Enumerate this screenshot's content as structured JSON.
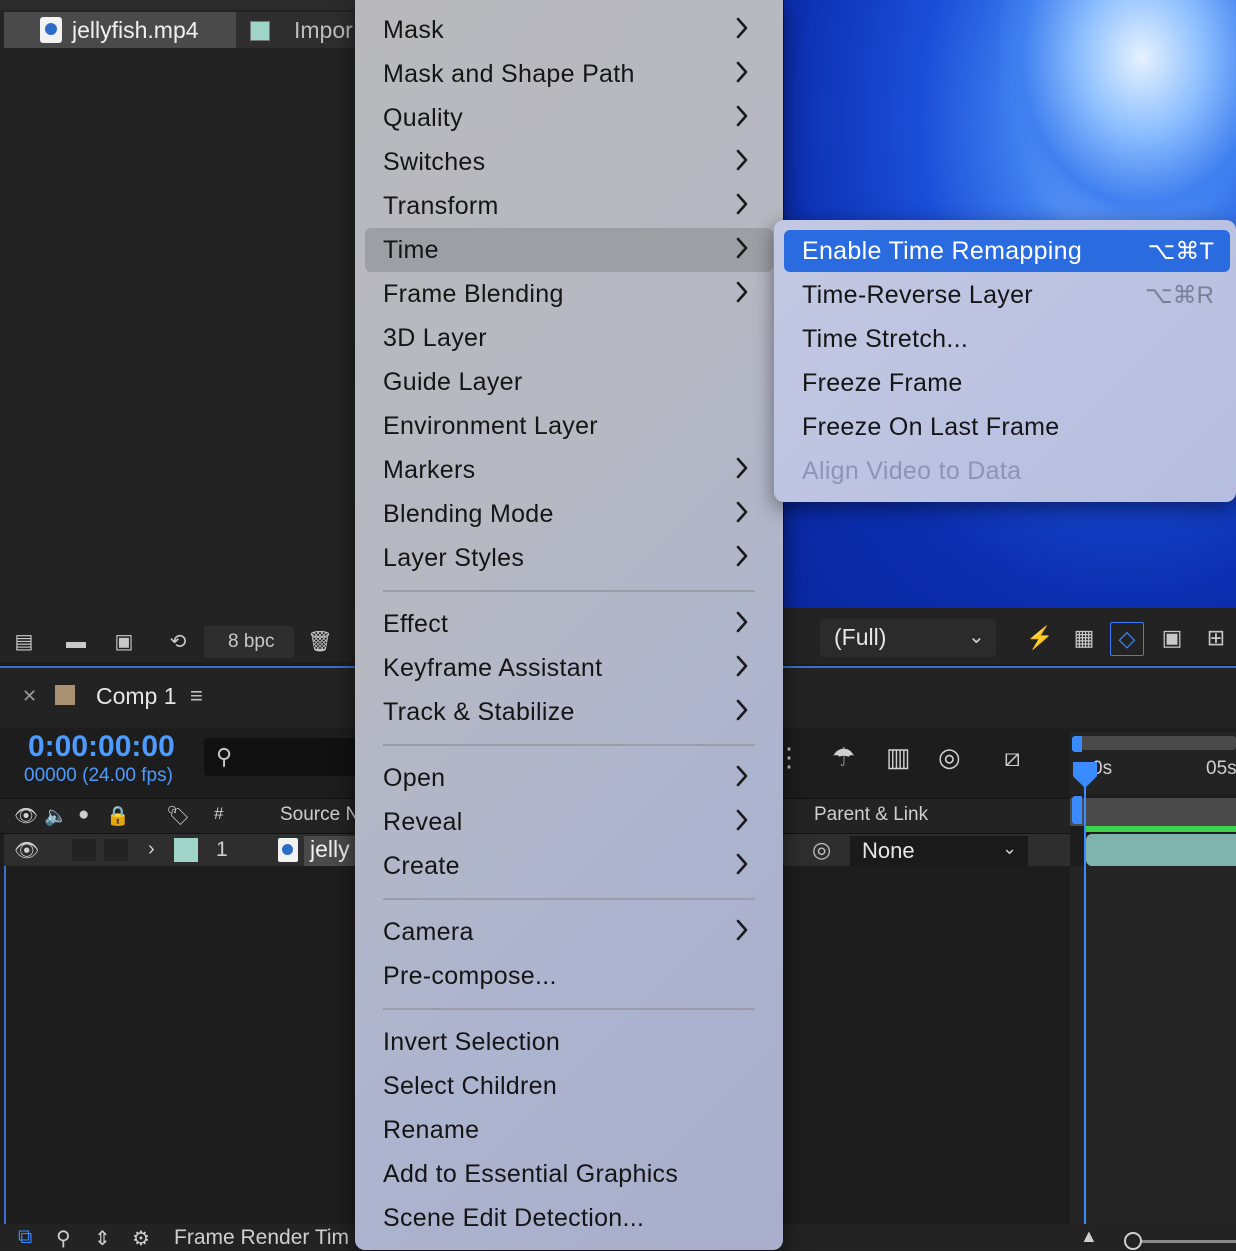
{
  "project": {
    "file_name": "jellyfish.mp4",
    "file_type": "Impor",
    "bpc": "8 bpc"
  },
  "viewer": {
    "resolution": "(Full)"
  },
  "timeline": {
    "tab_title": "Comp 1",
    "timecode": "0:00:00:00",
    "frames": "00000 (24.00 fps)",
    "columns": {
      "hash": "#",
      "source": "Source N",
      "parent": "Parent & Link"
    },
    "layer": {
      "number": "1",
      "name": "jelly",
      "parent": "None"
    },
    "ruler": {
      "start": "0s",
      "mark": "05s"
    },
    "status": "Frame Render Tim"
  },
  "menu": {
    "items": [
      {
        "label": "Mask"
      },
      {
        "label": "Mask and Shape Path"
      },
      {
        "label": "Quality"
      },
      {
        "label": "Switches"
      },
      {
        "label": "Transform"
      },
      {
        "label": "Time"
      },
      {
        "label": "Frame Blending"
      },
      {
        "label": "3D Layer"
      },
      {
        "label": "Guide Layer"
      },
      {
        "label": "Environment Layer"
      },
      {
        "label": "Markers"
      },
      {
        "label": "Blending Mode"
      },
      {
        "label": "Layer Styles"
      },
      {
        "label": "Effect"
      },
      {
        "label": "Keyframe Assistant"
      },
      {
        "label": "Track & Stabilize"
      },
      {
        "label": "Open"
      },
      {
        "label": "Reveal"
      },
      {
        "label": "Create"
      },
      {
        "label": "Camera"
      },
      {
        "label": "Pre-compose..."
      },
      {
        "label": "Invert Selection"
      },
      {
        "label": "Select Children"
      },
      {
        "label": "Rename"
      },
      {
        "label": "Add to Essential Graphics"
      },
      {
        "label": "Scene Edit Detection..."
      }
    ]
  },
  "submenu": {
    "items": [
      {
        "label": "Enable Time Remapping",
        "shortcut": "⌥⌘T"
      },
      {
        "label": "Time-Reverse Layer",
        "shortcut": "⌥⌘R"
      },
      {
        "label": "Time Stretch..."
      },
      {
        "label": "Freeze Frame"
      },
      {
        "label": "Freeze On Last Frame"
      },
      {
        "label": "Align Video to Data"
      }
    ]
  },
  "colors": {
    "accent": "#2a6ce0",
    "timecode": "#4d9bff",
    "layer_label": "#9fd4c9",
    "comp_label": "#a89070"
  }
}
